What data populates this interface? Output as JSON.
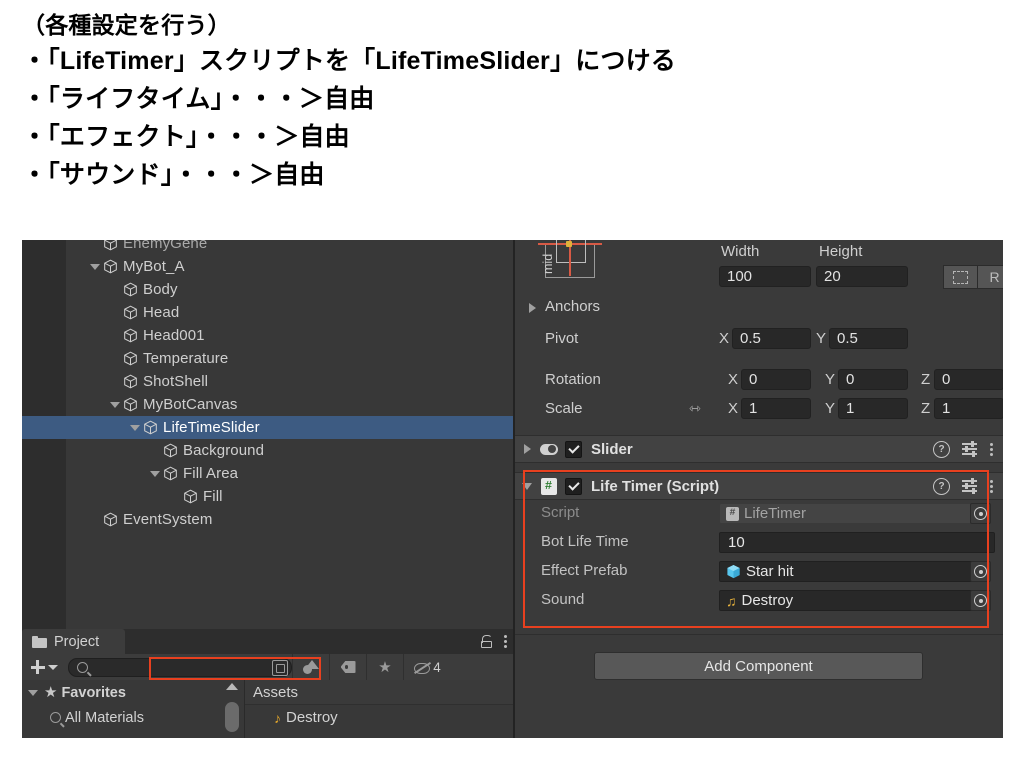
{
  "slide": {
    "lines": [
      "（各種設定を行う）",
      "・「LifeTimer」スクリプトを「LifeTimeSlider」につける",
      "・「ライフタイム」・・・＞自由",
      "・「エフェクト」・・・＞自由",
      "・「サウンド」・・・＞自由"
    ]
  },
  "hierarchy": {
    "items": [
      {
        "label": "EnemyGene",
        "indent": 1,
        "expanded": false,
        "clipped": true,
        "selected": false
      },
      {
        "label": "MyBot_A",
        "indent": 1,
        "expanded": true,
        "clipped": false,
        "selected": false
      },
      {
        "label": "Body",
        "indent": 2,
        "expanded": false,
        "clipped": false,
        "selected": false
      },
      {
        "label": "Head",
        "indent": 2,
        "expanded": false,
        "clipped": false,
        "selected": false
      },
      {
        "label": "Head001",
        "indent": 2,
        "expanded": false,
        "clipped": false,
        "selected": false
      },
      {
        "label": "Temperature",
        "indent": 2,
        "expanded": false,
        "clipped": false,
        "selected": false
      },
      {
        "label": "ShotShell",
        "indent": 2,
        "expanded": false,
        "clipped": false,
        "selected": false
      },
      {
        "label": "MyBotCanvas",
        "indent": 2,
        "expanded": true,
        "clipped": false,
        "selected": false
      },
      {
        "label": "LifeTimeSlider",
        "indent": 3,
        "expanded": true,
        "clipped": false,
        "selected": true
      },
      {
        "label": "Background",
        "indent": 4,
        "expanded": false,
        "clipped": false,
        "selected": false
      },
      {
        "label": "Fill Area",
        "indent": 4,
        "expanded": true,
        "clipped": false,
        "selected": false
      },
      {
        "label": "Fill",
        "indent": 5,
        "expanded": false,
        "clipped": false,
        "selected": false
      },
      {
        "label": "EventSystem",
        "indent": 1,
        "expanded": false,
        "clipped": false,
        "selected": false
      }
    ]
  },
  "inspector": {
    "rect_transform": {
      "anchor_preset_label": "mid",
      "width_header": "Width",
      "height_header": "Height",
      "width_value": "100",
      "height_value": "20",
      "blueprint_button": "",
      "raw_button": "R",
      "anchors_label": "Anchors",
      "pivot_label": "Pivot",
      "pivot_x_axis": "X",
      "pivot_x": "0.5",
      "pivot_y_axis": "Y",
      "pivot_y": "0.5",
      "rotation_label": "Rotation",
      "rotation_x_axis": "X",
      "rotation_x": "0",
      "rotation_y_axis": "Y",
      "rotation_y": "0",
      "rotation_z_axis": "Z",
      "rotation_z": "0",
      "scale_label": "Scale",
      "scale_x_axis": "X",
      "scale_x": "1",
      "scale_y_axis": "Y",
      "scale_y": "1",
      "scale_z_axis": "Z",
      "scale_z": "1"
    },
    "components": [
      {
        "title": "Slider",
        "icon": "slider-icon",
        "expanded": false,
        "enabled": true
      },
      {
        "title": "Life Timer (Script)",
        "icon": "csharp-script-icon",
        "expanded": true,
        "enabled": true
      }
    ],
    "life_timer_props": [
      {
        "label": "Script",
        "value": "LifeTimer",
        "icon": "csharp-script-icon",
        "dim": true,
        "picker": true
      },
      {
        "label": "Bot Life Time",
        "value": "10",
        "icon": "none",
        "dim": false,
        "picker": false
      },
      {
        "label": "Effect Prefab",
        "value": "Star hit",
        "icon": "prefab-cube-icon",
        "dim": false,
        "picker": true
      },
      {
        "label": "Sound",
        "value": "Destroy",
        "icon": "audio-note-icon",
        "dim": false,
        "picker": true
      }
    ],
    "add_component_label": "Add Component",
    "help_icon": "?",
    "preset_icon": "preset-icon",
    "menu_icon": "kebab-menu-icon"
  },
  "project": {
    "tab_label": "Project",
    "search_value": "",
    "search_placeholder": "",
    "hidden_count": "4",
    "favorites_label": "Favorites",
    "favorites_children": [
      "All Materials"
    ],
    "assets_header": "Assets",
    "assets_items": [
      {
        "label": "Destroy",
        "icon": "audio-note-icon"
      }
    ]
  },
  "colors": {
    "highlight_red": "#e8401f",
    "selection_blue": "#3d5b82",
    "panel_bg": "#383838",
    "inspector_bg": "#3a3a3a",
    "field_bg": "#282828"
  }
}
